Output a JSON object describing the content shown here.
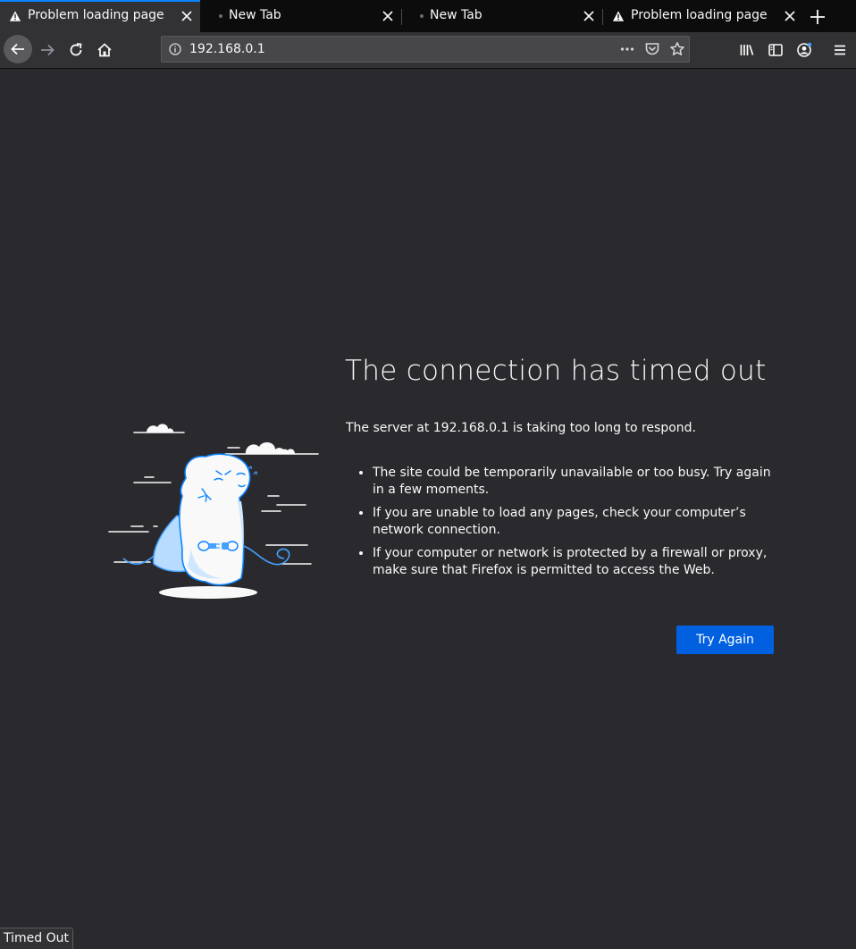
{
  "colors": {
    "tabstrip_bg": "#0c0c0d",
    "toolbar_bg": "#323234",
    "content_bg": "#2a2a2e",
    "accent_blue": "#0a84ff",
    "button_blue": "#0060df",
    "text": "#f9f9fa"
  },
  "tabs": [
    {
      "label": "Problem loading page",
      "icon": "warning-icon",
      "active": true
    },
    {
      "label": "New Tab",
      "icon": "loading-dot-icon",
      "active": false
    },
    {
      "label": "New Tab",
      "icon": "loading-dot-icon",
      "active": false
    },
    {
      "label": "Problem loading page",
      "icon": "warning-icon",
      "active": false
    }
  ],
  "urlbar": {
    "url": "192.168.0.1"
  },
  "error": {
    "title": "The connection has timed out",
    "description": "The server at 192.168.0.1 is taking too long to respond.",
    "suggestions": [
      "The site could be temporarily unavailable or too busy. Try again in a few moments.",
      "If you are unable to load any pages, check your computer’s network connection.",
      "If your computer or network is protected by a firewall or proxy, make sure that Firefox is permitted to access the Web."
    ],
    "try_again_label": "Try Again"
  },
  "status": {
    "text": "Timed Out"
  }
}
